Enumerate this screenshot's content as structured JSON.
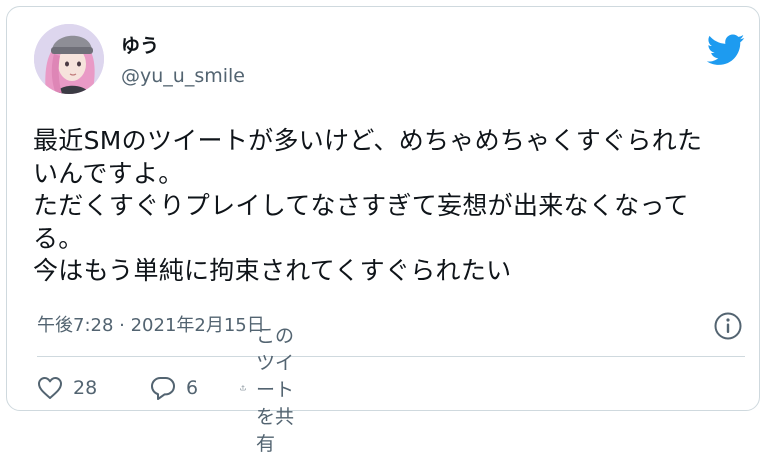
{
  "user": {
    "display_name": "ゆう",
    "handle": "@yu_u_smile"
  },
  "tweet": {
    "text": "最近SMのツイートが多いけど、めちゃめちゃくすぐられた\nいんですよ。\nただくすぐりプレイしてなさすぎて妄想が出来なくなって\nる。\n今はもう単純に拘束されてくすぐられたい",
    "timestamp": "午後7:28 · 2021年2月15日"
  },
  "actions": {
    "likes": "28",
    "replies": "6",
    "share_label": "このツイートを共有"
  },
  "icons": {
    "brand": "twitter-bird-icon",
    "info": "info-icon",
    "like": "heart-icon",
    "reply": "reply-bubble-icon",
    "share": "share-icon"
  },
  "colors": {
    "brand": "#1d9bf0",
    "secondary_text": "#536471",
    "border": "#cfd9de"
  }
}
